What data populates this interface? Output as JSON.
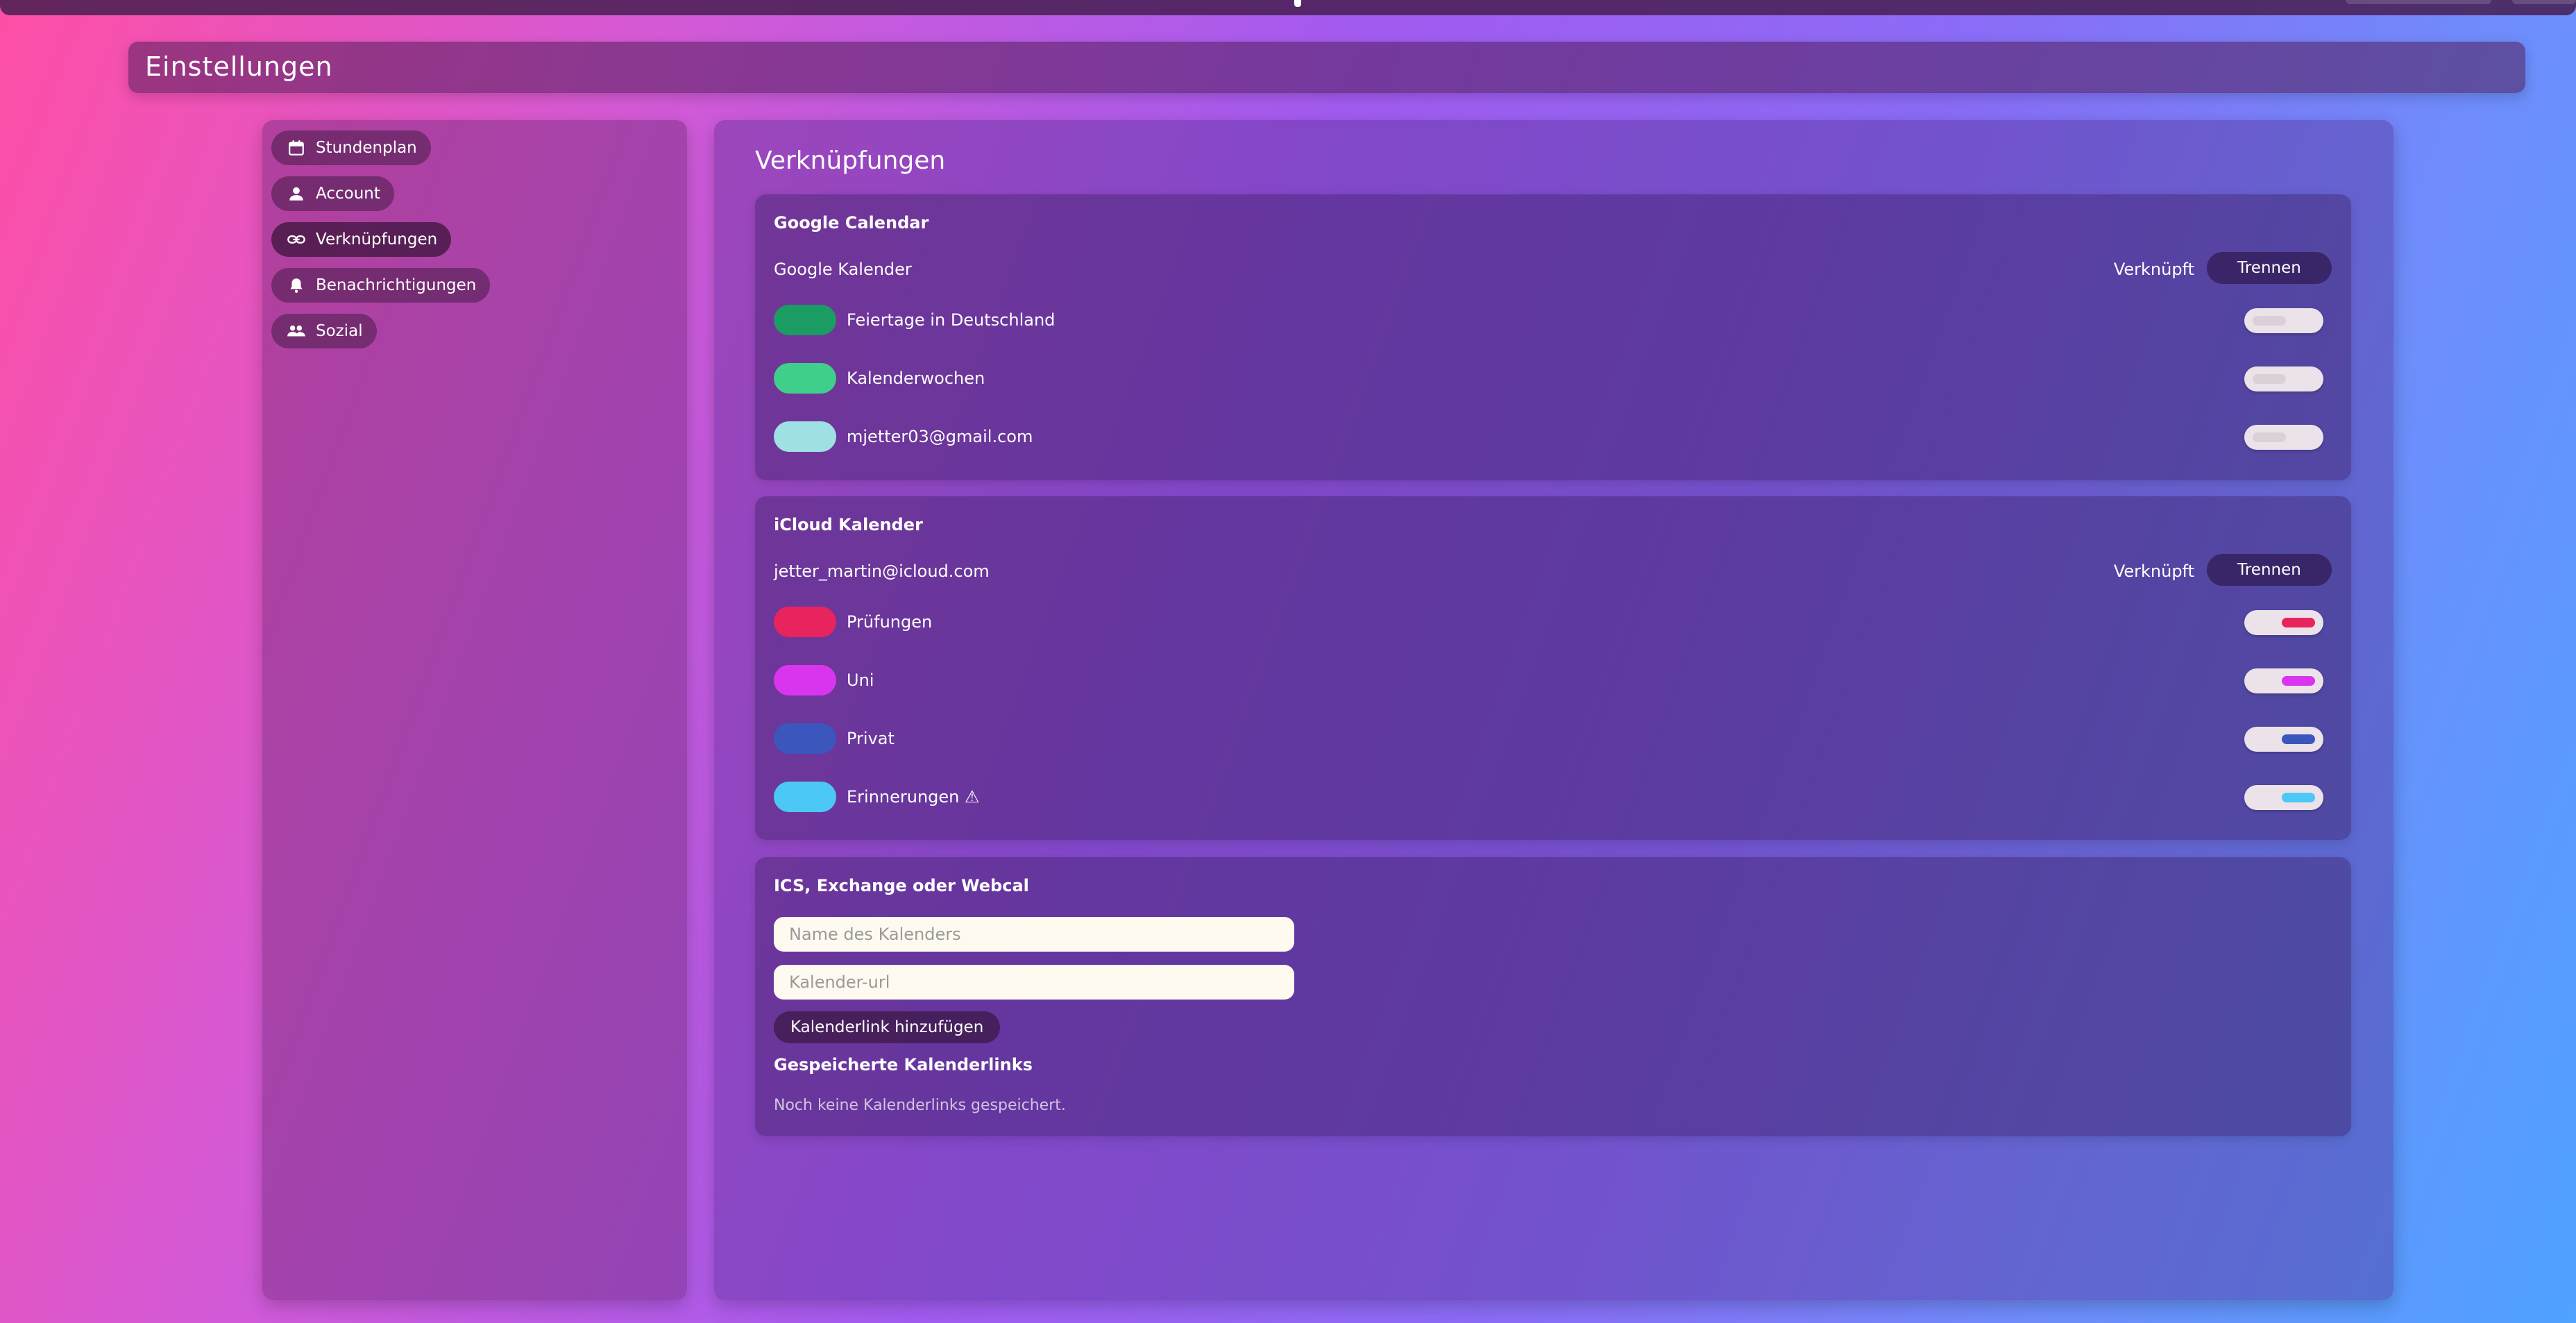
{
  "header": {
    "title": "Einstellungen"
  },
  "sidebar": {
    "items": [
      {
        "label": "Stundenplan",
        "icon": "calendar-icon",
        "active": false
      },
      {
        "label": "Account",
        "icon": "person-icon",
        "active": false
      },
      {
        "label": "Verknüpfungen",
        "icon": "link-icon",
        "active": true
      },
      {
        "label": "Benachrichtigungen",
        "icon": "bell-icon",
        "active": false
      },
      {
        "label": "Sozial",
        "icon": "people-icon",
        "active": false
      }
    ]
  },
  "main": {
    "title": "Verknüpfungen",
    "google": {
      "title": "Google Calendar",
      "account": "Google Kalender",
      "status": "Verknüpft",
      "disconnect": "Trennen",
      "calendars": [
        {
          "name": "Feiertage in Deutschland",
          "color": "#1b9c62",
          "enabled": false
        },
        {
          "name": "Kalenderwochen",
          "color": "#3fcf8a",
          "enabled": false
        },
        {
          "name": "mjetter03@gmail.com",
          "color": "#9fe0e4",
          "enabled": false
        }
      ]
    },
    "icloud": {
      "title": "iCloud Kalender",
      "account": "jetter_martin@icloud.com",
      "status": "Verknüpft",
      "disconnect": "Trennen",
      "calendars": [
        {
          "name": "Prüfungen",
          "color": "#e8245e",
          "enabled": true
        },
        {
          "name": "Uni",
          "color": "#d935ef",
          "enabled": true
        },
        {
          "name": "Privat",
          "color": "#3b56bd",
          "enabled": true
        },
        {
          "name": "Erinnerungen ⚠",
          "color": "#4cc8f7",
          "enabled": true
        }
      ]
    },
    "ics": {
      "title": "ICS, Exchange oder Webcal",
      "name_placeholder": "Name des Kalenders",
      "url_placeholder": "Kalender-url",
      "add_button": "Kalenderlink hinzufügen",
      "saved_title": "Gespeicherte Kalenderlinks",
      "empty_text": "Noch keine Kalenderlinks gespeichert."
    }
  }
}
